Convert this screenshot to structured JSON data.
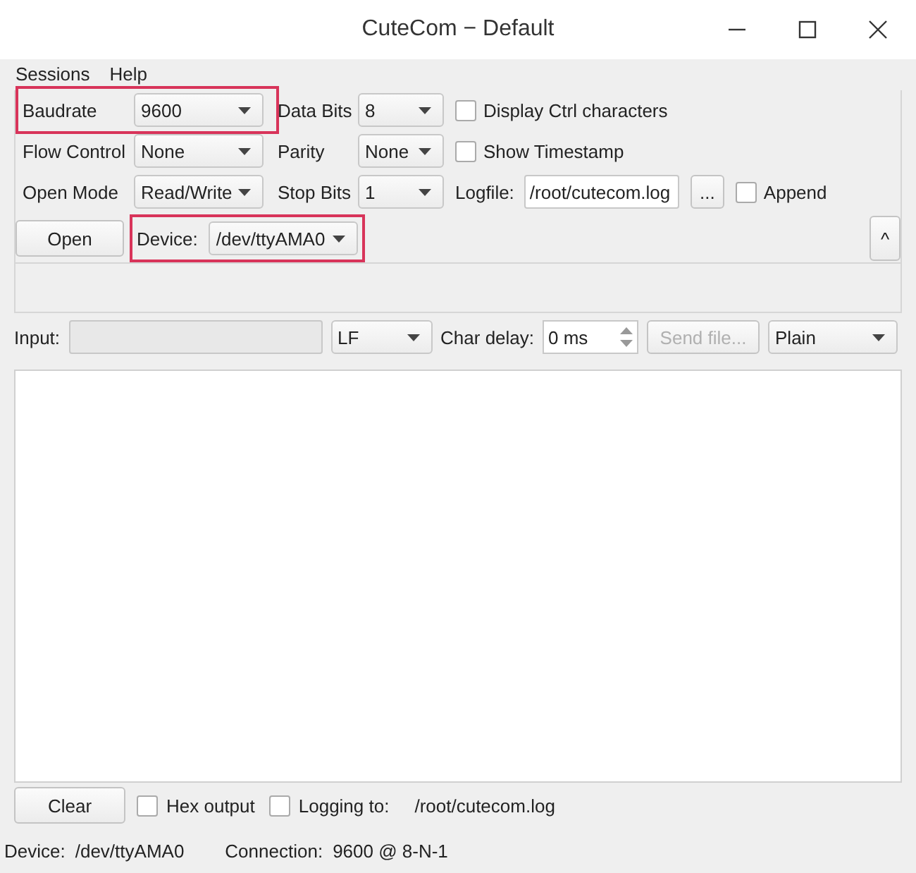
{
  "window": {
    "title": "CuteCom − Default"
  },
  "menu": [
    "Sessions",
    "Help"
  ],
  "settings": {
    "fields": [
      {
        "label": "Baudrate",
        "value": "9600",
        "highlighted": true
      },
      {
        "label": "Data Bits",
        "value": "8",
        "highlighted": false
      },
      {
        "label": "Flow Control",
        "value": "None",
        "highlighted": false
      },
      {
        "label": "Parity",
        "value": "None",
        "highlighted": false
      },
      {
        "label": "Open Mode",
        "value": "Read/Write",
        "highlighted": false
      },
      {
        "label": "Stop Bits",
        "value": "1",
        "highlighted": false
      }
    ],
    "options": [
      {
        "label": "Display Ctrl characters",
        "checked": false
      },
      {
        "label": "Show Timestamp",
        "checked": false
      }
    ],
    "logfile": {
      "label": "Logfile:",
      "value": "/root/cutecom.log",
      "browse": "...",
      "append": {
        "label": "Append",
        "checked": false
      }
    },
    "open_button": "Open",
    "device": {
      "label": "Device:",
      "value": "/dev/ttyAMA0",
      "highlighted": true
    },
    "collapse_button": "^"
  },
  "input": {
    "label": "Input:",
    "line_ending": "LF",
    "char_delay_label": "Char delay:",
    "char_delay": "0 ms",
    "send_file": {
      "label": "Send file...",
      "disabled": true
    },
    "format": "Plain"
  },
  "bottom": {
    "clear": "Clear",
    "hex_output": {
      "label": "Hex output",
      "checked": false
    },
    "logging": {
      "label": "Logging to:",
      "checked": false
    },
    "log_path": "/root/cutecom.log"
  },
  "status_bar": [
    {
      "label": "Device:",
      "value": "/dev/ttyAMA0"
    },
    {
      "label": "Connection:",
      "value": "9600 @ 8-N-1"
    }
  ]
}
